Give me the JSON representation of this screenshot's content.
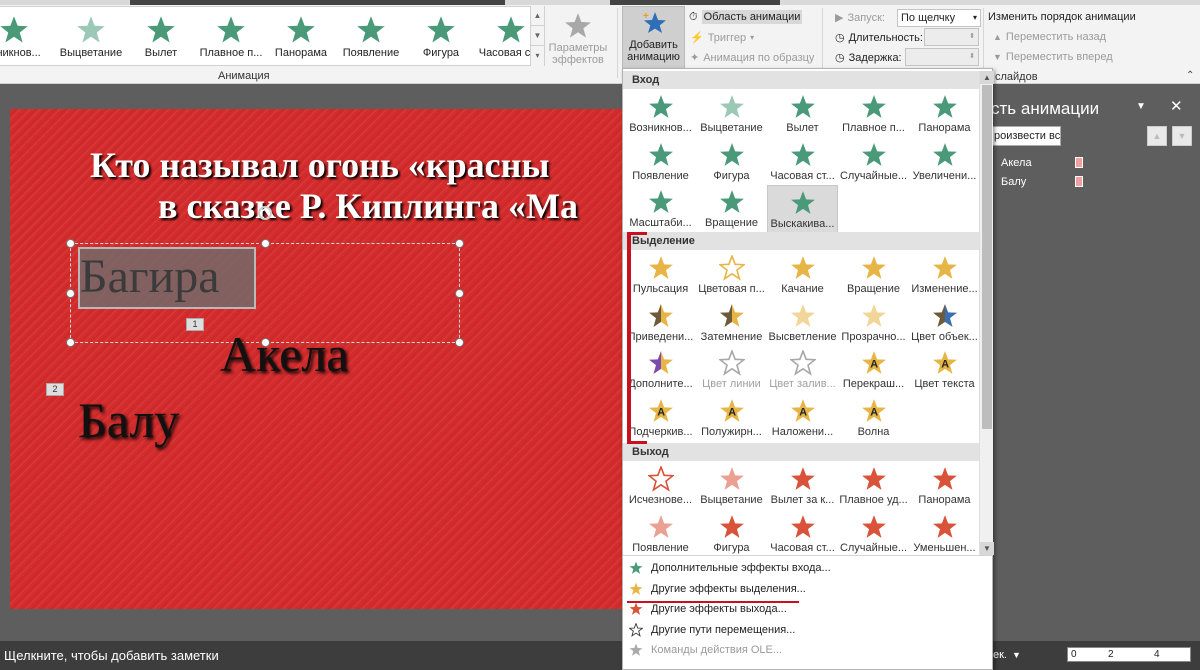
{
  "ribbon": {
    "gallery": [
      {
        "label": "...никнов...",
        "icon": "appear-star-icon"
      },
      {
        "label": "Выцветание",
        "icon": "fade-star-icon"
      },
      {
        "label": "Вылет",
        "icon": "fly-in-star-icon"
      },
      {
        "label": "Плавное п...",
        "icon": "float-in-star-icon"
      },
      {
        "label": "Панорама",
        "icon": "split-star-icon"
      },
      {
        "label": "Появление",
        "icon": "wipe-star-icon"
      },
      {
        "label": "Фигура",
        "icon": "shape-star-icon"
      },
      {
        "label": "Часовая ст...",
        "icon": "wheel-star-icon"
      }
    ],
    "effect_options_label": "Параметры эффектов",
    "group_animation_label": "Анимация",
    "add_animation_label": "Добавить анимацию",
    "animation_pane_label": "Область анимации",
    "trigger_label": "Триггер",
    "painter_label": "Анимация по образцу",
    "start_label": "Запуск:",
    "start_value": "По щелчку",
    "duration_label": "Длительность:",
    "delay_label": "Задержка:",
    "reorder_title": "Изменить порядок анимации",
    "move_earlier": "Переместить назад",
    "move_later": "Переместить вперед",
    "slides_label": "слайдов"
  },
  "slide": {
    "title_line1": "Кто называл огонь «красны",
    "title_line2": "в сказке Р. Киплинга «Ма",
    "text1": "Багира",
    "text2": "Акела",
    "text3": "Балу",
    "tag1": "1",
    "tag2": "2"
  },
  "panel": {
    "title": "сть анимации",
    "play_all": "роизвести все",
    "items": [
      "Акела",
      "Балу"
    ],
    "close": "✕"
  },
  "dropdown": {
    "sections": [
      {
        "title": "Вход",
        "color": "#4a9a7a",
        "items": [
          "Возникнов...",
          "Выцветание",
          "Вылет",
          "Плавное п...",
          "Панорама",
          "Появление",
          "Фигура",
          "Часовая ст...",
          "Случайные...",
          "Увеличени...",
          "Масштаби...",
          "Вращение",
          "Выскакива..."
        ]
      },
      {
        "title": "Выделение",
        "color": "#e7b545",
        "items": [
          "Пульсация",
          "Цветовая п...",
          "Качание",
          "Вращение",
          "Изменение...",
          "Приведени...",
          "Затемнение",
          "Высветление",
          "Прозрачно...",
          "Цвет объек...",
          "Дополните...",
          "Цвет линии",
          "Цвет залив...",
          "Перекраш...",
          "Цвет текста",
          "Подчеркив...",
          "Полужирн...",
          "Наложени...",
          "Волна"
        ]
      },
      {
        "title": "Выход",
        "color": "#d9533a",
        "items": [
          "Исчезнове...",
          "Выцветание",
          "Вылет за к...",
          "Плавное уд...",
          "Панорама",
          "Появление",
          "Фигура",
          "Часовая ст...",
          "Случайные...",
          "Уменьшен..."
        ]
      }
    ],
    "more": [
      "Дополнительные эффекты входа...",
      "Другие эффекты выделения...",
      "Другие эффекты выхода...",
      "Другие пути перемещения...",
      "Команды действия OLE..."
    ]
  },
  "status": {
    "notes": "Щелкните, чтобы добавить заметки",
    "zoom_label": "ек.",
    "timeline_ticks": [
      "0",
      "2",
      "4"
    ]
  },
  "colors": {
    "entrance": "#4a9a7a",
    "emphasis": "#e7b545",
    "exit": "#d9533a",
    "slide_bg": "#d42c2c"
  }
}
